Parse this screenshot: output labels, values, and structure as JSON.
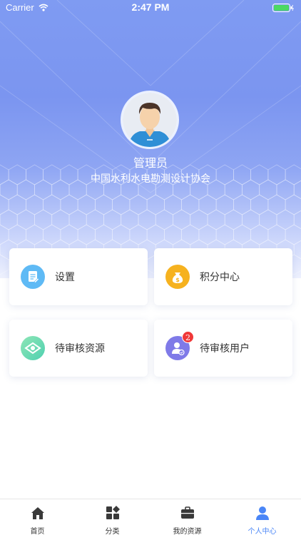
{
  "status_bar": {
    "carrier": "Carrier",
    "time": "2:47 PM"
  },
  "profile": {
    "name": "管理员",
    "organization": "中国水利水电勘测设计协会"
  },
  "cards": [
    {
      "label": "设置",
      "icon": "document-edit-icon",
      "color": "#5fbaf5"
    },
    {
      "label": "积分中心",
      "icon": "money-bag-icon",
      "color": "#f6b21f"
    },
    {
      "label": "待审核资源",
      "icon": "eye-icon",
      "color": "#5ed7ab"
    },
    {
      "label": "待审核用户",
      "icon": "user-check-icon",
      "color": "#7f7ae8",
      "badge": "2"
    }
  ],
  "tabbar": {
    "items": [
      {
        "label": "首页",
        "icon": "home-icon"
      },
      {
        "label": "分类",
        "icon": "category-grid-icon"
      },
      {
        "label": "我的资源",
        "icon": "briefcase-icon"
      },
      {
        "label": "个人中心",
        "icon": "person-icon",
        "active": true
      }
    ],
    "active_color": "#4a86f7"
  }
}
